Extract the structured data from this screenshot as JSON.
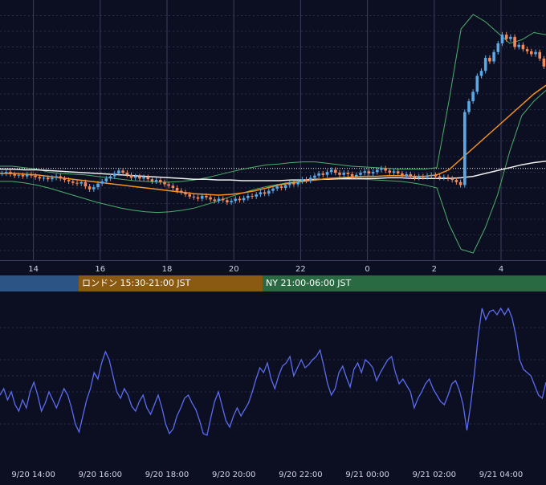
{
  "colors": {
    "background": "#0c0f22",
    "grid": "#2a2f48",
    "candle_up": "#5aa9e6",
    "candle_down": "#f08a5d",
    "ma_fast": "#f7931e",
    "ma_slow": "#f0f0f0",
    "bollinger": "#4caf6a",
    "oscillator": "#5b6cf0",
    "session_tokyo": "#2c5485",
    "session_london": "#8a5a12",
    "session_ny": "#2a6a43",
    "current_price_line": "#ffffff"
  },
  "sessions": [
    {
      "label": "",
      "color": "#2c5485"
    },
    {
      "label": "ロンドン 15:30-21:00 JST",
      "color": "#8a5a12"
    },
    {
      "label": "NY 21:00-06:00 JST",
      "color": "#2a6a43"
    }
  ],
  "chart_data": [
    {
      "type": "candlestick",
      "title": "",
      "x_tick_labels": [
        "14",
        "16",
        "18",
        "20",
        "22",
        "0",
        "2",
        "4"
      ],
      "x_hours_from_1300": [
        1,
        3,
        5,
        7,
        9,
        11,
        13,
        15
      ],
      "grid": true,
      "closes": [
        100.0,
        100.2,
        99.9,
        99.7,
        99.8,
        99.6,
        99.9,
        99.7,
        99.5,
        99.3,
        99.4,
        99.2,
        99.4,
        99.6,
        99.3,
        99.1,
        98.9,
        98.7,
        98.6,
        98.8,
        98.2,
        97.8,
        98.1,
        98.6,
        98.9,
        99.3,
        99.6,
        100.0,
        100.4,
        100.1,
        99.8,
        99.4,
        99.6,
        99.3,
        99.5,
        99.2,
        98.9,
        99.1,
        98.8,
        98.5,
        98.3,
        98.0,
        97.6,
        97.4,
        97.1,
        96.8,
        96.7,
        96.5,
        96.9,
        96.7,
        96.4,
        96.2,
        96.5,
        96.3,
        96.0,
        96.2,
        96.5,
        96.3,
        96.6,
        96.9,
        96.8,
        97.1,
        97.4,
        97.2,
        97.6,
        97.9,
        98.2,
        98.0,
        98.4,
        98.7,
        98.5,
        98.9,
        99.2,
        99.0,
        99.4,
        99.7,
        100.0,
        99.8,
        100.2,
        100.5,
        100.1,
        99.8,
        100.1,
        99.9,
        99.6,
        99.8,
        100.1,
        100.3,
        100.0,
        100.2,
        100.5,
        100.7,
        100.4,
        100.1,
        100.3,
        100.0,
        99.7,
        99.9,
        99.6,
        99.4,
        99.6,
        99.5,
        99.7,
        99.8,
        99.6,
        99.4,
        99.5,
        99.3,
        99.1,
        98.8,
        98.4,
        108.5,
        110.0,
        111.3,
        113.5,
        114.2,
        116.0,
        115.5,
        116.8,
        118.0,
        119.2,
        118.6,
        118.9,
        117.5,
        117.8,
        117.2,
        116.9,
        116.5,
        116.8,
        115.9,
        114.8
      ],
      "ma_fast": [
        100.0,
        100.0,
        99.9,
        99.8,
        99.6,
        99.4,
        99.2,
        99.0,
        98.8,
        98.6,
        98.4,
        98.2,
        98.0,
        97.8,
        97.6,
        97.4,
        97.2,
        97.1,
        97.0,
        97.1,
        97.3,
        97.6,
        98.0,
        98.4,
        98.7,
        98.9,
        99.1,
        99.3,
        99.4,
        99.5,
        99.6,
        99.6,
        99.7,
        99.7,
        99.6,
        99.6,
        99.8,
        100.5,
        102.0,
        103.5,
        105.0,
        106.5,
        108.0,
        109.5,
        111.0,
        112.2
      ],
      "ma_slow": [
        100.6,
        100.6,
        100.5,
        100.5,
        100.4,
        100.3,
        100.2,
        100.1,
        100.0,
        99.9,
        99.8,
        99.7,
        99.6,
        99.5,
        99.4,
        99.3,
        99.2,
        99.2,
        99.1,
        99.1,
        99.0,
        99.0,
        99.0,
        99.0,
        99.1,
        99.1,
        99.2,
        99.2,
        99.3,
        99.3,
        99.3,
        99.3,
        99.4,
        99.4,
        99.3,
        99.3,
        99.3,
        99.3,
        99.4,
        99.6,
        100.0,
        100.4,
        100.8,
        101.2,
        101.5,
        101.7
      ],
      "boll_upper": [
        101.0,
        101.0,
        100.8,
        100.6,
        100.2,
        100.0,
        99.9,
        99.8,
        99.6,
        99.4,
        99.2,
        99.0,
        98.9,
        98.8,
        98.8,
        98.9,
        99.1,
        99.4,
        99.8,
        100.2,
        100.6,
        100.9,
        101.2,
        101.3,
        101.5,
        101.6,
        101.6,
        101.4,
        101.2,
        101.0,
        100.9,
        100.8,
        100.7,
        100.6,
        100.6,
        100.6,
        100.8,
        110.0,
        120.0,
        122.0,
        121.0,
        119.5,
        118.0,
        118.5,
        119.5,
        119.2
      ],
      "boll_lower": [
        98.9,
        98.9,
        98.7,
        98.4,
        98.0,
        97.5,
        97.0,
        96.5,
        96.0,
        95.6,
        95.2,
        94.9,
        94.7,
        94.6,
        94.7,
        94.9,
        95.2,
        95.7,
        96.2,
        96.8,
        97.3,
        97.8,
        98.2,
        98.5,
        98.8,
        99.0,
        99.1,
        99.2,
        99.2,
        99.2,
        99.2,
        99.1,
        99.0,
        98.9,
        98.7,
        98.4,
        98.0,
        93.0,
        89.5,
        89.0,
        92.5,
        97.0,
        103.0,
        108.0,
        110.0,
        111.5
      ],
      "ylim": [
        88.0,
        124.0
      ],
      "current_price": 100.7,
      "session_markers_hours": [
        22.0,
        23.5,
        23.9,
        25.5,
        26.3
      ]
    },
    {
      "type": "line",
      "title": "",
      "x_tick_labels": [
        "9/20 14:00",
        "9/20 16:00",
        "9/20 18:00",
        "9/20 20:00",
        "9/20 22:00",
        "9/21 00:00",
        "9/21 02:00",
        "9/21 04:00"
      ],
      "x_hours_from_1300": [
        1,
        3,
        5,
        7,
        9,
        11,
        13,
        15
      ],
      "grid": true,
      "ylim": [
        0,
        100
      ],
      "series": [
        {
          "values": [
            38,
            42,
            35,
            40,
            32,
            28,
            35,
            30,
            40,
            46,
            38,
            28,
            33,
            40,
            35,
            30,
            36,
            42,
            38,
            30,
            20,
            15,
            25,
            35,
            42,
            52,
            48,
            58,
            65,
            60,
            50,
            40,
            36,
            42,
            38,
            31,
            28,
            34,
            38,
            30,
            26,
            32,
            38,
            30,
            20,
            14,
            17,
            25,
            30,
            36,
            38,
            33,
            29,
            22,
            14,
            13,
            24,
            34,
            40,
            31,
            22,
            18,
            25,
            30,
            25,
            29,
            33,
            40,
            48,
            55,
            52,
            58,
            48,
            42,
            50,
            56,
            58,
            62,
            50,
            55,
            60,
            55,
            57,
            60,
            62,
            66,
            56,
            45,
            38,
            42,
            52,
            56,
            49,
            43,
            54,
            58,
            52,
            60,
            58,
            55,
            47,
            52,
            56,
            60,
            62,
            52,
            45,
            48,
            44,
            40,
            30,
            36,
            40,
            45,
            48,
            42,
            38,
            34,
            32,
            38,
            45,
            47,
            41,
            32,
            16,
            32,
            52,
            75,
            92,
            85,
            90,
            91,
            88,
            92,
            88,
            92,
            86,
            75,
            60,
            54,
            52,
            50,
            44,
            38,
            36,
            46
          ]
        }
      ]
    }
  ]
}
